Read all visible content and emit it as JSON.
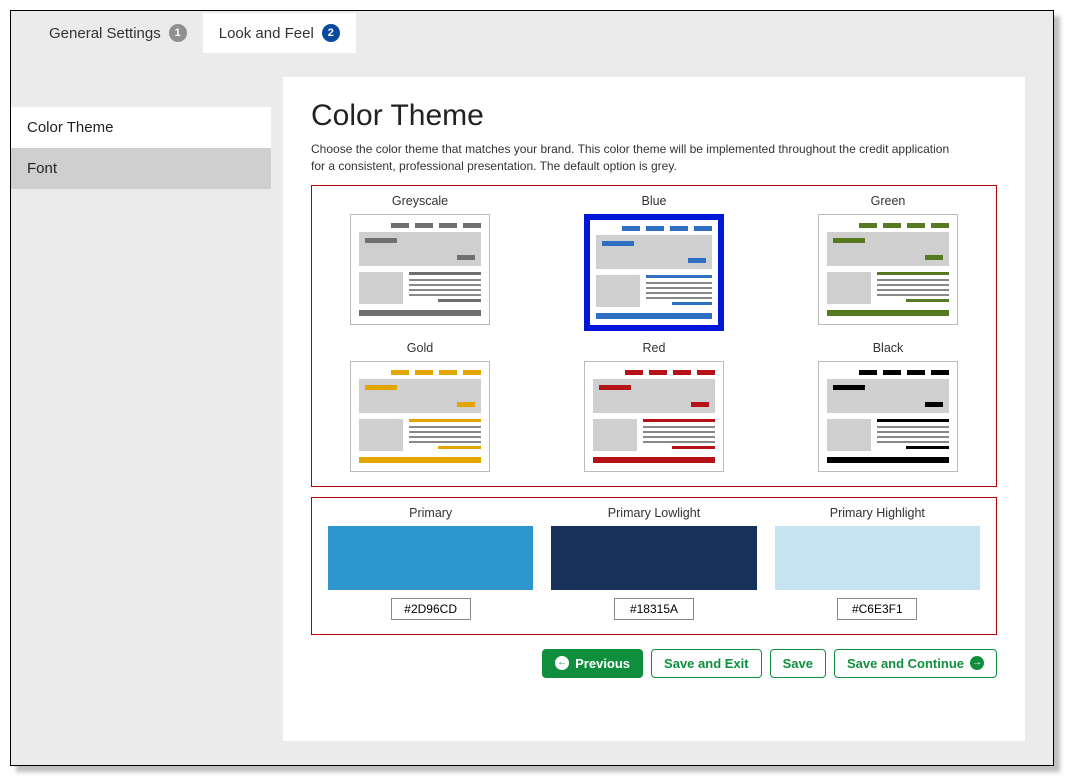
{
  "tabs": [
    {
      "label": "General Settings",
      "badge": "1",
      "badgeColor": "grey",
      "active": false
    },
    {
      "label": "Look and Feel",
      "badge": "2",
      "badgeColor": "blue",
      "active": true
    }
  ],
  "sidebar": {
    "items": [
      {
        "label": "Color Theme",
        "active": true
      },
      {
        "label": "Font",
        "active": false
      }
    ]
  },
  "page": {
    "title": "Color Theme",
    "description": "Choose the color theme that matches your brand. This color theme will be implemented throughout the credit application for a consistent, professional presentation. The default option is grey."
  },
  "themes": [
    {
      "label": "Greyscale",
      "accent": "#6f6f6f",
      "selected": false
    },
    {
      "label": "Blue",
      "accent": "#2e6fc1",
      "selected": true
    },
    {
      "label": "Green",
      "accent": "#567a1f",
      "selected": false
    },
    {
      "label": "Gold",
      "accent": "#e3a500",
      "selected": false
    },
    {
      "label": "Red",
      "accent": "#b51217",
      "selected": false
    },
    {
      "label": "Black",
      "accent": "#000000",
      "selected": false
    }
  ],
  "swatches": [
    {
      "label": "Primary",
      "hex": "#2D96CD"
    },
    {
      "label": "Primary Lowlight",
      "hex": "#18315A"
    },
    {
      "label": "Primary Highlight",
      "hex": "#C6E3F1"
    }
  ],
  "buttons": {
    "previous": "Previous",
    "saveExit": "Save and Exit",
    "save": "Save",
    "saveContinue": "Save and Continue"
  }
}
